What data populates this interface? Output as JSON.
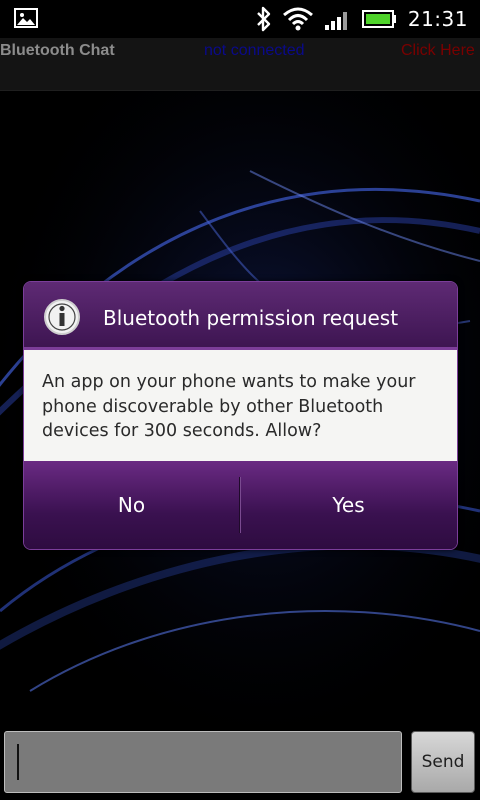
{
  "status_bar": {
    "time": "21:31",
    "icons": [
      "image-notification-icon",
      "bluetooth-icon",
      "wifi-icon",
      "signal-icon",
      "battery-icon"
    ]
  },
  "app_bar": {
    "title": "Bluetooth Chat",
    "connection_status": "not connected",
    "action": "Click Here"
  },
  "dialog": {
    "icon": "info-icon",
    "title": "Bluetooth permission request",
    "message": "An app on your phone wants to make your phone discoverable by other Bluetooth devices for 300 seconds. Allow?",
    "buttons": {
      "no": "No",
      "yes": "Yes"
    }
  },
  "composer": {
    "input_value": "",
    "send_label": "Send"
  },
  "colors": {
    "dialog_purple": "#4a1a60",
    "status_blue": "#0a0a8a",
    "action_red": "#7a0000"
  }
}
